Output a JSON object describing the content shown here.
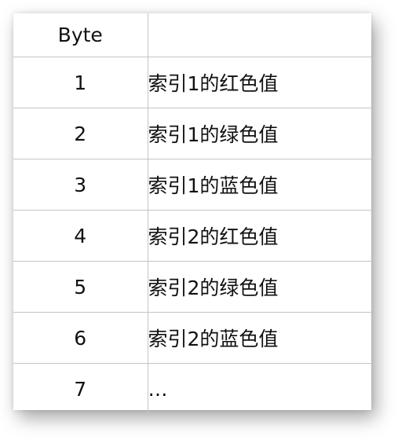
{
  "table": {
    "headers": [
      "Byte",
      ""
    ],
    "rows": [
      {
        "byte": "1",
        "desc": "索引1的红色值"
      },
      {
        "byte": "2",
        "desc": "索引1的绿色值"
      },
      {
        "byte": "3",
        "desc": "索引1的蓝色值"
      },
      {
        "byte": "4",
        "desc": "索引2的红色值"
      },
      {
        "byte": "5",
        "desc": "索引2的绿色值"
      },
      {
        "byte": "6",
        "desc": "索引2的蓝色值"
      },
      {
        "byte": "7",
        "desc": "…"
      }
    ]
  }
}
